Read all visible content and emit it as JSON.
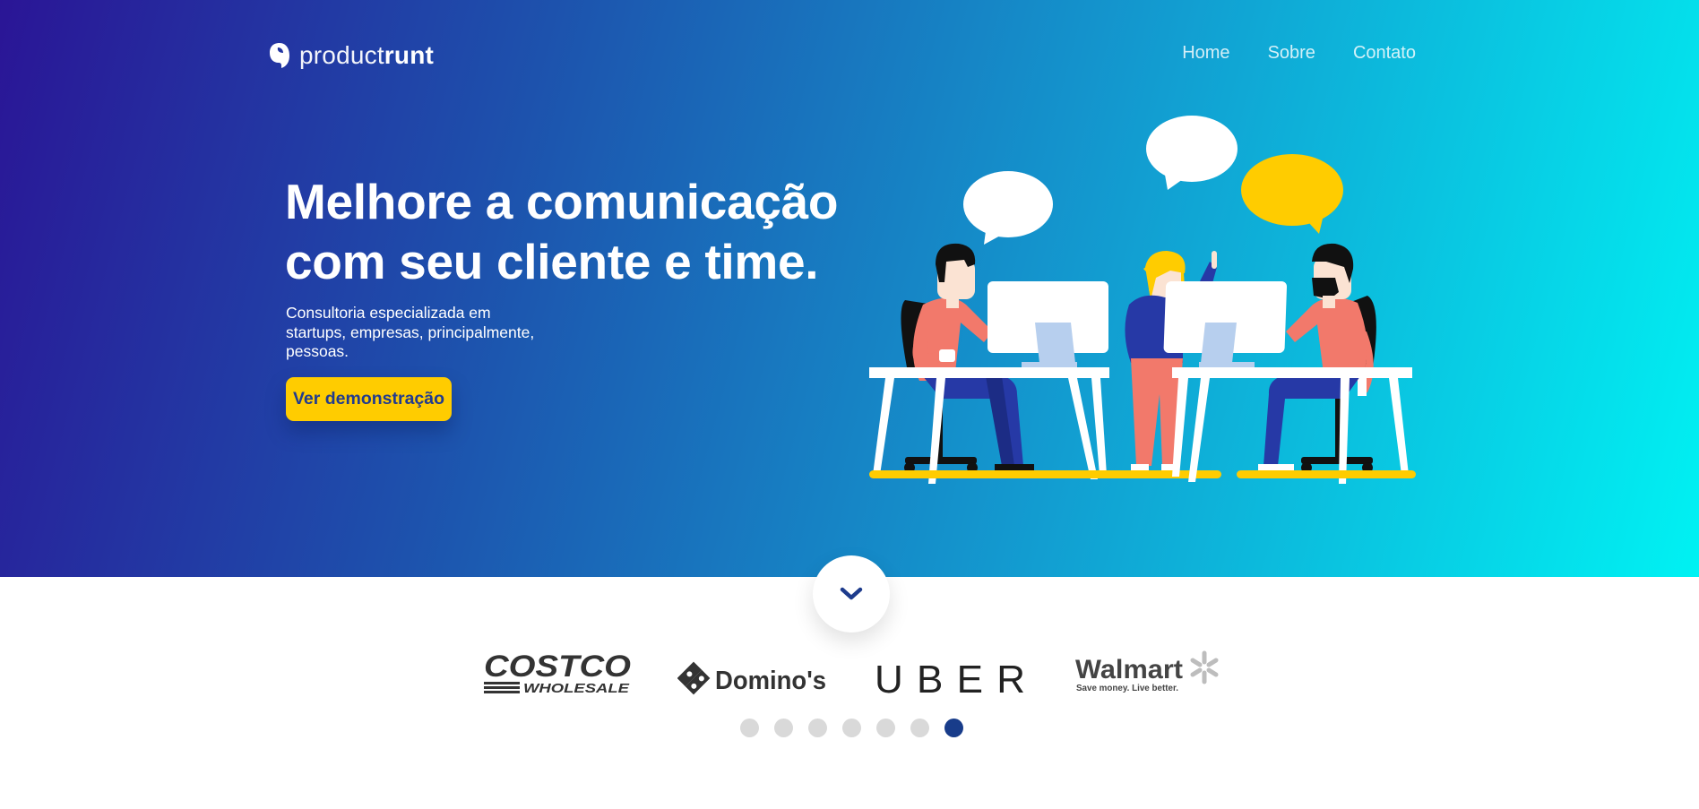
{
  "brand": {
    "name_light": "product",
    "name_bold": "runt",
    "icon": "leaf-logo-icon"
  },
  "nav": {
    "items": [
      {
        "label": "Home"
      },
      {
        "label": "Sobre"
      },
      {
        "label": "Contato"
      }
    ]
  },
  "hero": {
    "headline_line1": "Melhore a comunicação",
    "headline_line2": "com seu cliente e time.",
    "subtitle": "Consultoria especializada em startups, empresas, principalmente, pessoas.",
    "cta_label": "Ver demonstração",
    "illustration": "team-office-illustration",
    "scroll_icon": "chevron-down-icon"
  },
  "clients": {
    "logos": [
      {
        "name": "Costco",
        "line1": "COSTCO",
        "line2": "WHOLESALE"
      },
      {
        "name": "Domino's",
        "line1": "Domino's"
      },
      {
        "name": "Uber",
        "line1": "UBER"
      },
      {
        "name": "Walmart",
        "line1": "Walmart",
        "line2": "Save money. Live better."
      }
    ],
    "carousel_pages": 7,
    "active_page": 7
  },
  "colors": {
    "gradient_start": "#2a1596",
    "gradient_end": "#00f2f3",
    "accent": "#ffcc00",
    "cta_text": "#213b8f",
    "dot_active": "#183c8a",
    "dot_inactive": "#d9d9d9"
  }
}
